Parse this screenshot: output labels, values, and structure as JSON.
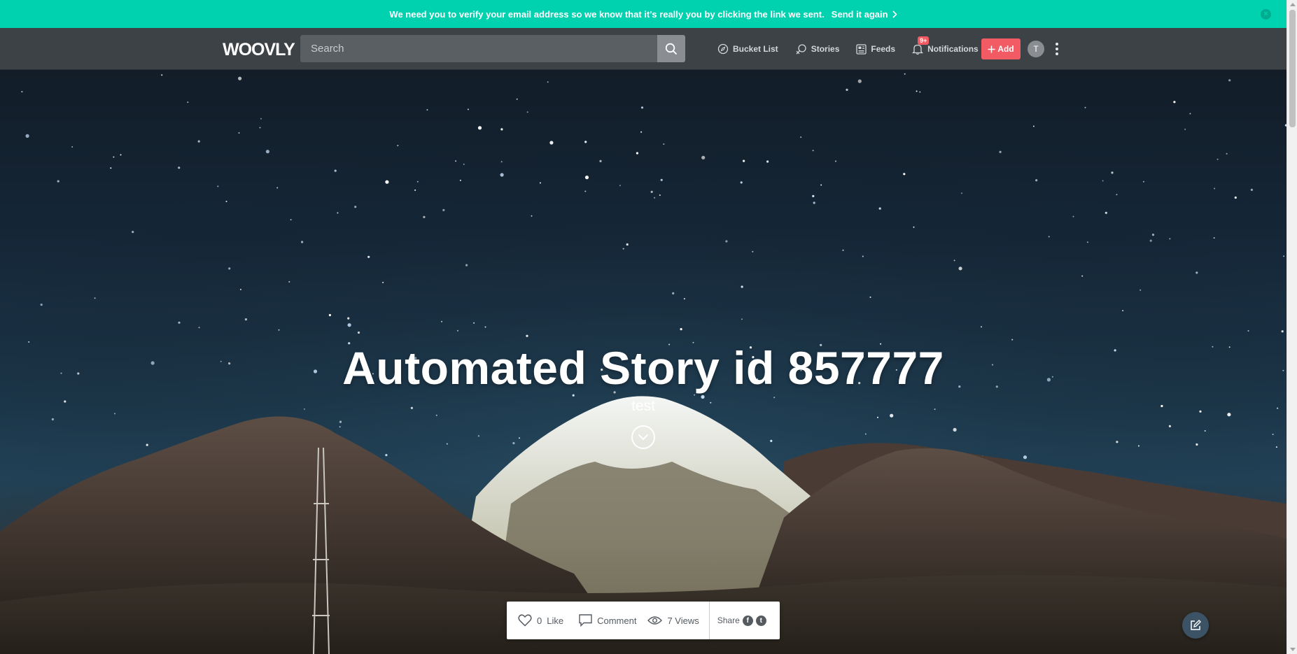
{
  "banner": {
    "message": "We need you to verify your email address so we know that it's really you by clicking the link we sent.",
    "action_label": "Send it again",
    "close_label": "×"
  },
  "navbar": {
    "logo": "WOOVLY",
    "search": {
      "placeholder": "Search",
      "value": ""
    },
    "links": {
      "bucket_list": "Bucket List",
      "stories": "Stories",
      "feeds": "Feeds",
      "notifications": "Notifications"
    },
    "notifications_badge": "9+",
    "add_label": "Add",
    "avatar_initial": "T"
  },
  "story": {
    "title": "Automated Story id 857777",
    "subtitle": "test"
  },
  "actions": {
    "likes_count": "0",
    "like_label": "Like",
    "comment_label": "Comment",
    "views_label": "7 Views",
    "share_label": "Share",
    "facebook_glyph": "f",
    "twitter_glyph": "t"
  },
  "colors": {
    "banner": "#00d2b0",
    "navbar": "#3d4247",
    "accent": "#f25a64"
  },
  "icons": {
    "bucket_list": "compass-icon",
    "stories": "stories-icon",
    "feeds": "feeds-icon",
    "notifications": "bell-icon",
    "edit": "edit-icon"
  }
}
